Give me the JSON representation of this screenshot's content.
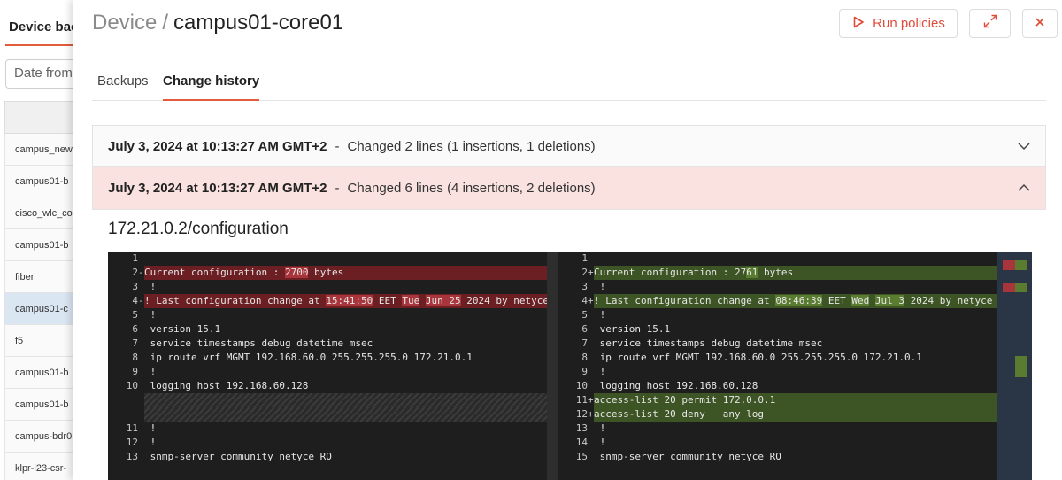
{
  "background": {
    "title": "Device bac",
    "date_placeholder": "Date from",
    "rows": [
      "campus_new",
      "campus01-b",
      "cisco_wlc_co",
      "campus01-b",
      "fiber",
      "campus01-c",
      "f5",
      "campus01-b",
      "campus01-b",
      "campus-bdr0",
      "klpr-l23-csr-"
    ],
    "selected_row_index": 5
  },
  "modal": {
    "breadcrumb": "Device",
    "separator": "/",
    "device_name": "campus01-core01",
    "run_policies_label": "Run policies",
    "tabs": [
      {
        "label": "Backups",
        "active": false
      },
      {
        "label": "Change history",
        "active": true
      }
    ],
    "history": [
      {
        "timestamp": "July 3, 2024 at 10:13:27 AM GMT+2",
        "summary": "Changed 2 lines (1 insertions, 1 deletions)",
        "expanded": false
      },
      {
        "timestamp": "July 3, 2024 at 10:13:27 AM GMT+2",
        "summary": "Changed 6 lines (4 insertions, 2 deletions)",
        "expanded": true
      }
    ],
    "config_path": "172.21.0.2/configuration"
  },
  "diff": {
    "left": [
      {
        "n": "1",
        "m": "",
        "t": "",
        "type": "ctx"
      },
      {
        "n": "2",
        "m": "-",
        "t": "Current configuration : 2700 bytes",
        "type": "del"
      },
      {
        "n": "3",
        "m": "",
        "t": " !",
        "type": "ctx"
      },
      {
        "n": "4",
        "m": "-",
        "t": "! Last configuration change at 15:41:50 EET Tue Jun 25 2024 by netyce",
        "type": "del"
      },
      {
        "n": "5",
        "m": "",
        "t": " !",
        "type": "ctx"
      },
      {
        "n": "6",
        "m": "",
        "t": " version 15.1",
        "type": "ctx"
      },
      {
        "n": "7",
        "m": "",
        "t": " service timestamps debug datetime msec",
        "type": "ctx"
      },
      {
        "n": "8",
        "m": "",
        "t": " ip route vrf MGMT 192.168.60.0 255.255.255.0 172.21.0.1",
        "type": "ctx"
      },
      {
        "n": "9",
        "m": "",
        "t": " !",
        "type": "ctx"
      },
      {
        "n": "10",
        "m": "",
        "t": " logging host 192.168.60.128",
        "type": "ctx"
      },
      {
        "n": "",
        "m": "",
        "t": "",
        "type": "pad"
      },
      {
        "n": "",
        "m": "",
        "t": "",
        "type": "pad"
      },
      {
        "n": "11",
        "m": "",
        "t": " !",
        "type": "ctx"
      },
      {
        "n": "12",
        "m": "",
        "t": " !",
        "type": "ctx"
      },
      {
        "n": "13",
        "m": "",
        "t": " snmp-server community netyce RO",
        "type": "ctx"
      }
    ],
    "right": [
      {
        "n": "1",
        "m": "",
        "t": "",
        "type": "ctx"
      },
      {
        "n": "2",
        "m": "+",
        "t": "Current configuration : 2761 bytes",
        "type": "add"
      },
      {
        "n": "3",
        "m": "",
        "t": " !",
        "type": "ctx"
      },
      {
        "n": "4",
        "m": "+",
        "t": "! Last configuration change at 08:46:39 EET Wed Jul 3 2024 by netyce",
        "type": "add"
      },
      {
        "n": "5",
        "m": "",
        "t": " !",
        "type": "ctx"
      },
      {
        "n": "6",
        "m": "",
        "t": " version 15.1",
        "type": "ctx"
      },
      {
        "n": "7",
        "m": "",
        "t": " service timestamps debug datetime msec",
        "type": "ctx"
      },
      {
        "n": "8",
        "m": "",
        "t": " ip route vrf MGMT 192.168.60.0 255.255.255.0 172.21.0.1",
        "type": "ctx"
      },
      {
        "n": "9",
        "m": "",
        "t": " !",
        "type": "ctx"
      },
      {
        "n": "10",
        "m": "",
        "t": " logging host 192.168.60.128",
        "type": "ctx"
      },
      {
        "n": "11",
        "m": "+",
        "t": "access-list 20 permit 172.0.0.1",
        "type": "add"
      },
      {
        "n": "12",
        "m": "+",
        "t": "access-list 20 deny   any log",
        "type": "add"
      },
      {
        "n": "13",
        "m": "",
        "t": " !",
        "type": "ctx"
      },
      {
        "n": "14",
        "m": "",
        "t": " !",
        "type": "ctx"
      },
      {
        "n": "15",
        "m": "",
        "t": " snmp-server community netyce RO",
        "type": "ctx"
      }
    ],
    "colors": {
      "deleted": "#6b1f23",
      "added": "#3d5524",
      "deleted_word": "#a8353b",
      "added_word": "#5a7c30",
      "accent": "#e15b3c"
    }
  }
}
